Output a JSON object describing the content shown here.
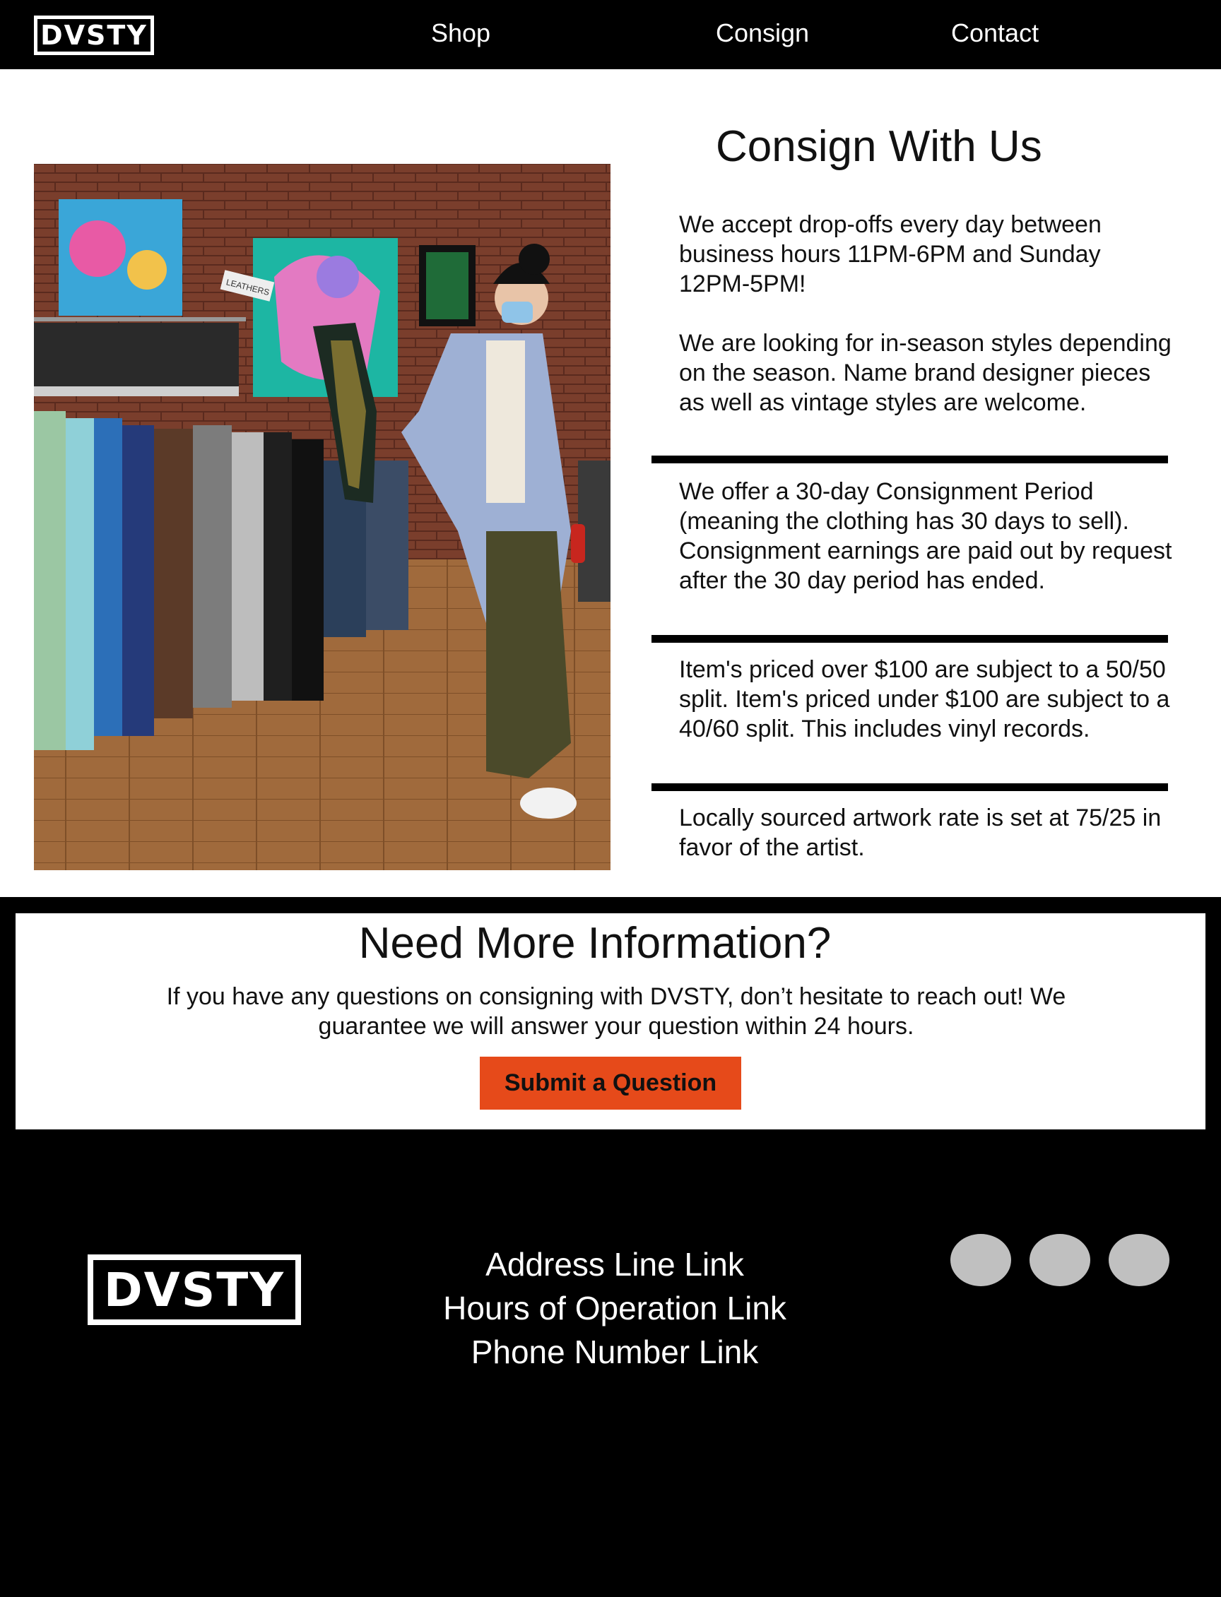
{
  "header": {
    "logo": "DVSTY",
    "nav": {
      "shop": "Shop",
      "consign": "Consign",
      "contact": "Contact"
    }
  },
  "main": {
    "title": "Consign With Us",
    "paragraphs": [
      "We accept drop-offs every day between business hours 11PM-6PM and Sunday 12PM-5PM!",
      "We are looking for in-season styles depending on the season. Name brand designer pieces as well as vintage styles are welcome.",
      "We offer a 30-day Consignment Period (meaning the clothing has 30 days to sell).  Consignment earnings are paid out by request after the 30 day period has ended.",
      "Item's priced over $100 are subject to a 50/50 split. Item's priced under $100 are subject to a 40/60 split. This includes vinyl records.",
      "Locally sourced artwork rate is set at 75/25 in favor of the artist."
    ],
    "photo_labels": {
      "sign": "LEATHERS"
    }
  },
  "info": {
    "title": "Need More Information?",
    "text": "If you have any questions on consigning with DVSTY, don’t hesitate to reach out! We guarantee we will answer your question within 24 hours.",
    "button": "Submit a Question"
  },
  "footer": {
    "logo": "DVSTY",
    "links": [
      "Address Line Link",
      "Hours of Operation Link",
      "Phone Number Link"
    ]
  },
  "colors": {
    "accent": "#e64a1a",
    "header_bg": "#000000",
    "social_placeholder": "#c0c0c0"
  }
}
